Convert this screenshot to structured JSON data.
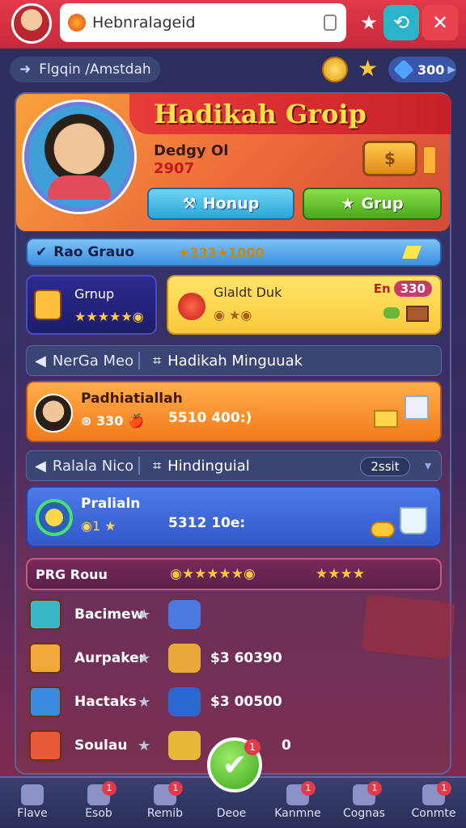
{
  "topbar": {
    "address_text": "Hebnralageid",
    "icons": [
      "avatar",
      "tab-favicon",
      "lock-icon",
      "star-icon",
      "share-icon",
      "close-icon"
    ]
  },
  "subheader": {
    "breadcrumb": "Flgqin /Amstdah",
    "gems": "300"
  },
  "profile": {
    "title": "Hadikah Groip",
    "name": "Dedgy Ol",
    "number": "2907",
    "buttons": {
      "primary": "Honup",
      "secondary": "Grup"
    }
  },
  "rao_row": {
    "label": "Rao Grauo",
    "stars": "★333★1000"
  },
  "grup_box": {
    "label": "Grnup",
    "stars": "★★★★★◉"
  },
  "yellow_tile": {
    "label": "Glaldt Duk",
    "mini": "◉ ★◉",
    "price_prefix": "En",
    "price": "330"
  },
  "nav1": {
    "left": "NerGa Meo",
    "right": "Hadikah Minguuak"
  },
  "orange_card": {
    "name": "Padhiatiallah",
    "meta": "330",
    "amount": "5510 400:)"
  },
  "nav2": {
    "left": "Ralala Nico",
    "right": "Hindinguial",
    "pill": "2ssit"
  },
  "blue_card": {
    "name": "Pralialn",
    "meta": "◉1",
    "amount": "5312 10e:"
  },
  "prg_row": {
    "label": "PRG Rouu",
    "stars1": "◉★★★★★◉",
    "stars2": "★★★★"
  },
  "items": [
    {
      "label": "Bacimew",
      "amount": ""
    },
    {
      "label": "Aurpaker",
      "amount": "$3 60390"
    },
    {
      "label": "Hactaks",
      "amount": "$3 00500"
    },
    {
      "label": "Soulau",
      "amount": "0"
    }
  ],
  "bottom_nav": [
    {
      "label": "Flave",
      "badge": ""
    },
    {
      "label": "Esob",
      "badge": "1"
    },
    {
      "label": "Remib",
      "badge": "1"
    },
    {
      "label": "Deoe",
      "badge": ""
    },
    {
      "label": "Kanmne",
      "badge": "1"
    },
    {
      "label": "Cognas",
      "badge": "1"
    },
    {
      "label": "Conmte",
      "badge": "1"
    }
  ],
  "fab_badge": "1",
  "colors": {
    "accent": "#e23a4a",
    "gold": "#ffc83a",
    "panel": "#2e376a"
  }
}
